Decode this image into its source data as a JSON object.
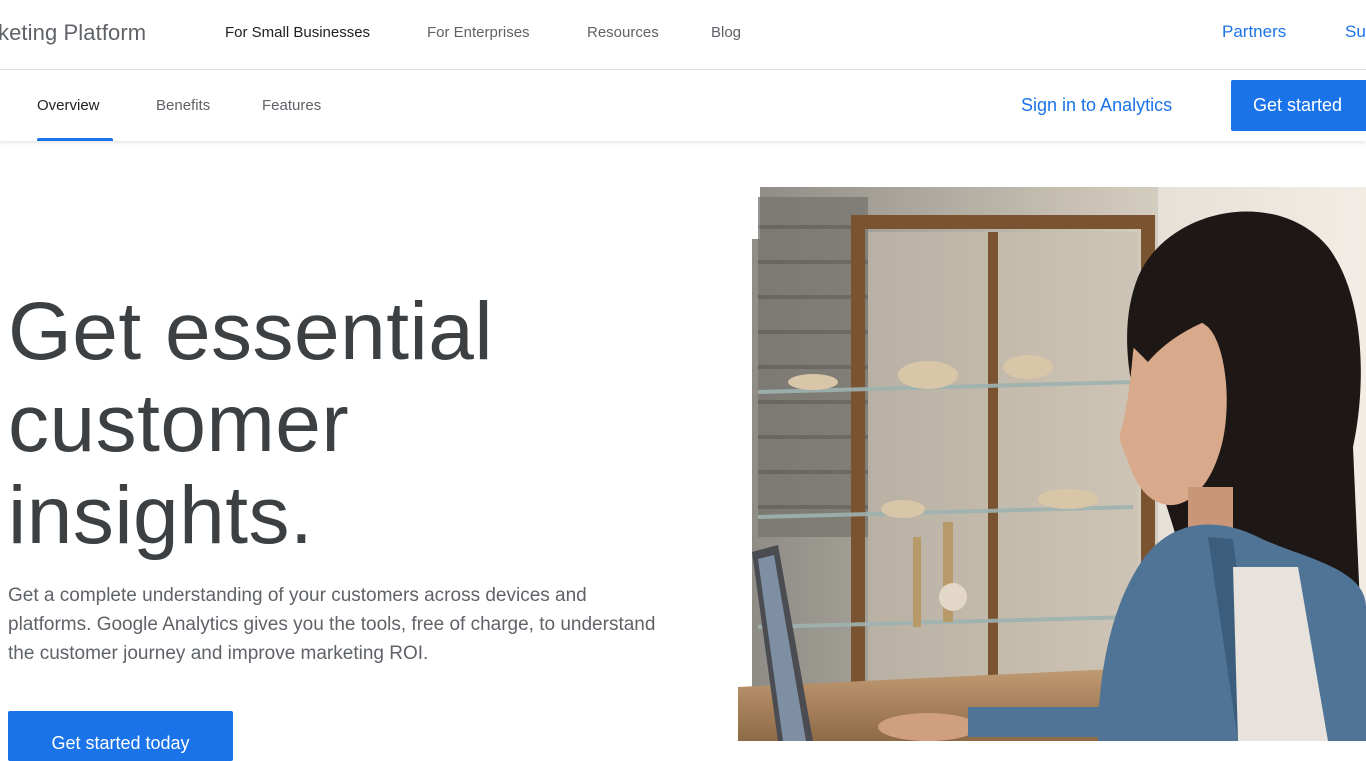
{
  "header": {
    "brand": "keting Platform",
    "nav": [
      {
        "label": "For Small Businesses"
      },
      {
        "label": "For Enterprises"
      },
      {
        "label": "Resources"
      },
      {
        "label": "Blog"
      }
    ],
    "links": {
      "partners": "Partners",
      "support": "Su"
    }
  },
  "subnav": {
    "tabs": [
      {
        "label": "Overview"
      },
      {
        "label": "Benefits"
      },
      {
        "label": "Features"
      }
    ],
    "signin": "Sign in to Analytics",
    "cta": "Get started"
  },
  "hero": {
    "title_line1": "Get essential",
    "title_line2": "customer",
    "title_line3": "insights.",
    "text": "Get a complete understanding of your customers across devices and platforms. Google Analytics gives you the tools, free of charge, to understand the customer journey and improve marketing ROI.",
    "cta": "Get started today"
  },
  "colors": {
    "accent": "#1a73e8",
    "heading": "#3c4043",
    "muted": "#5f6368"
  }
}
